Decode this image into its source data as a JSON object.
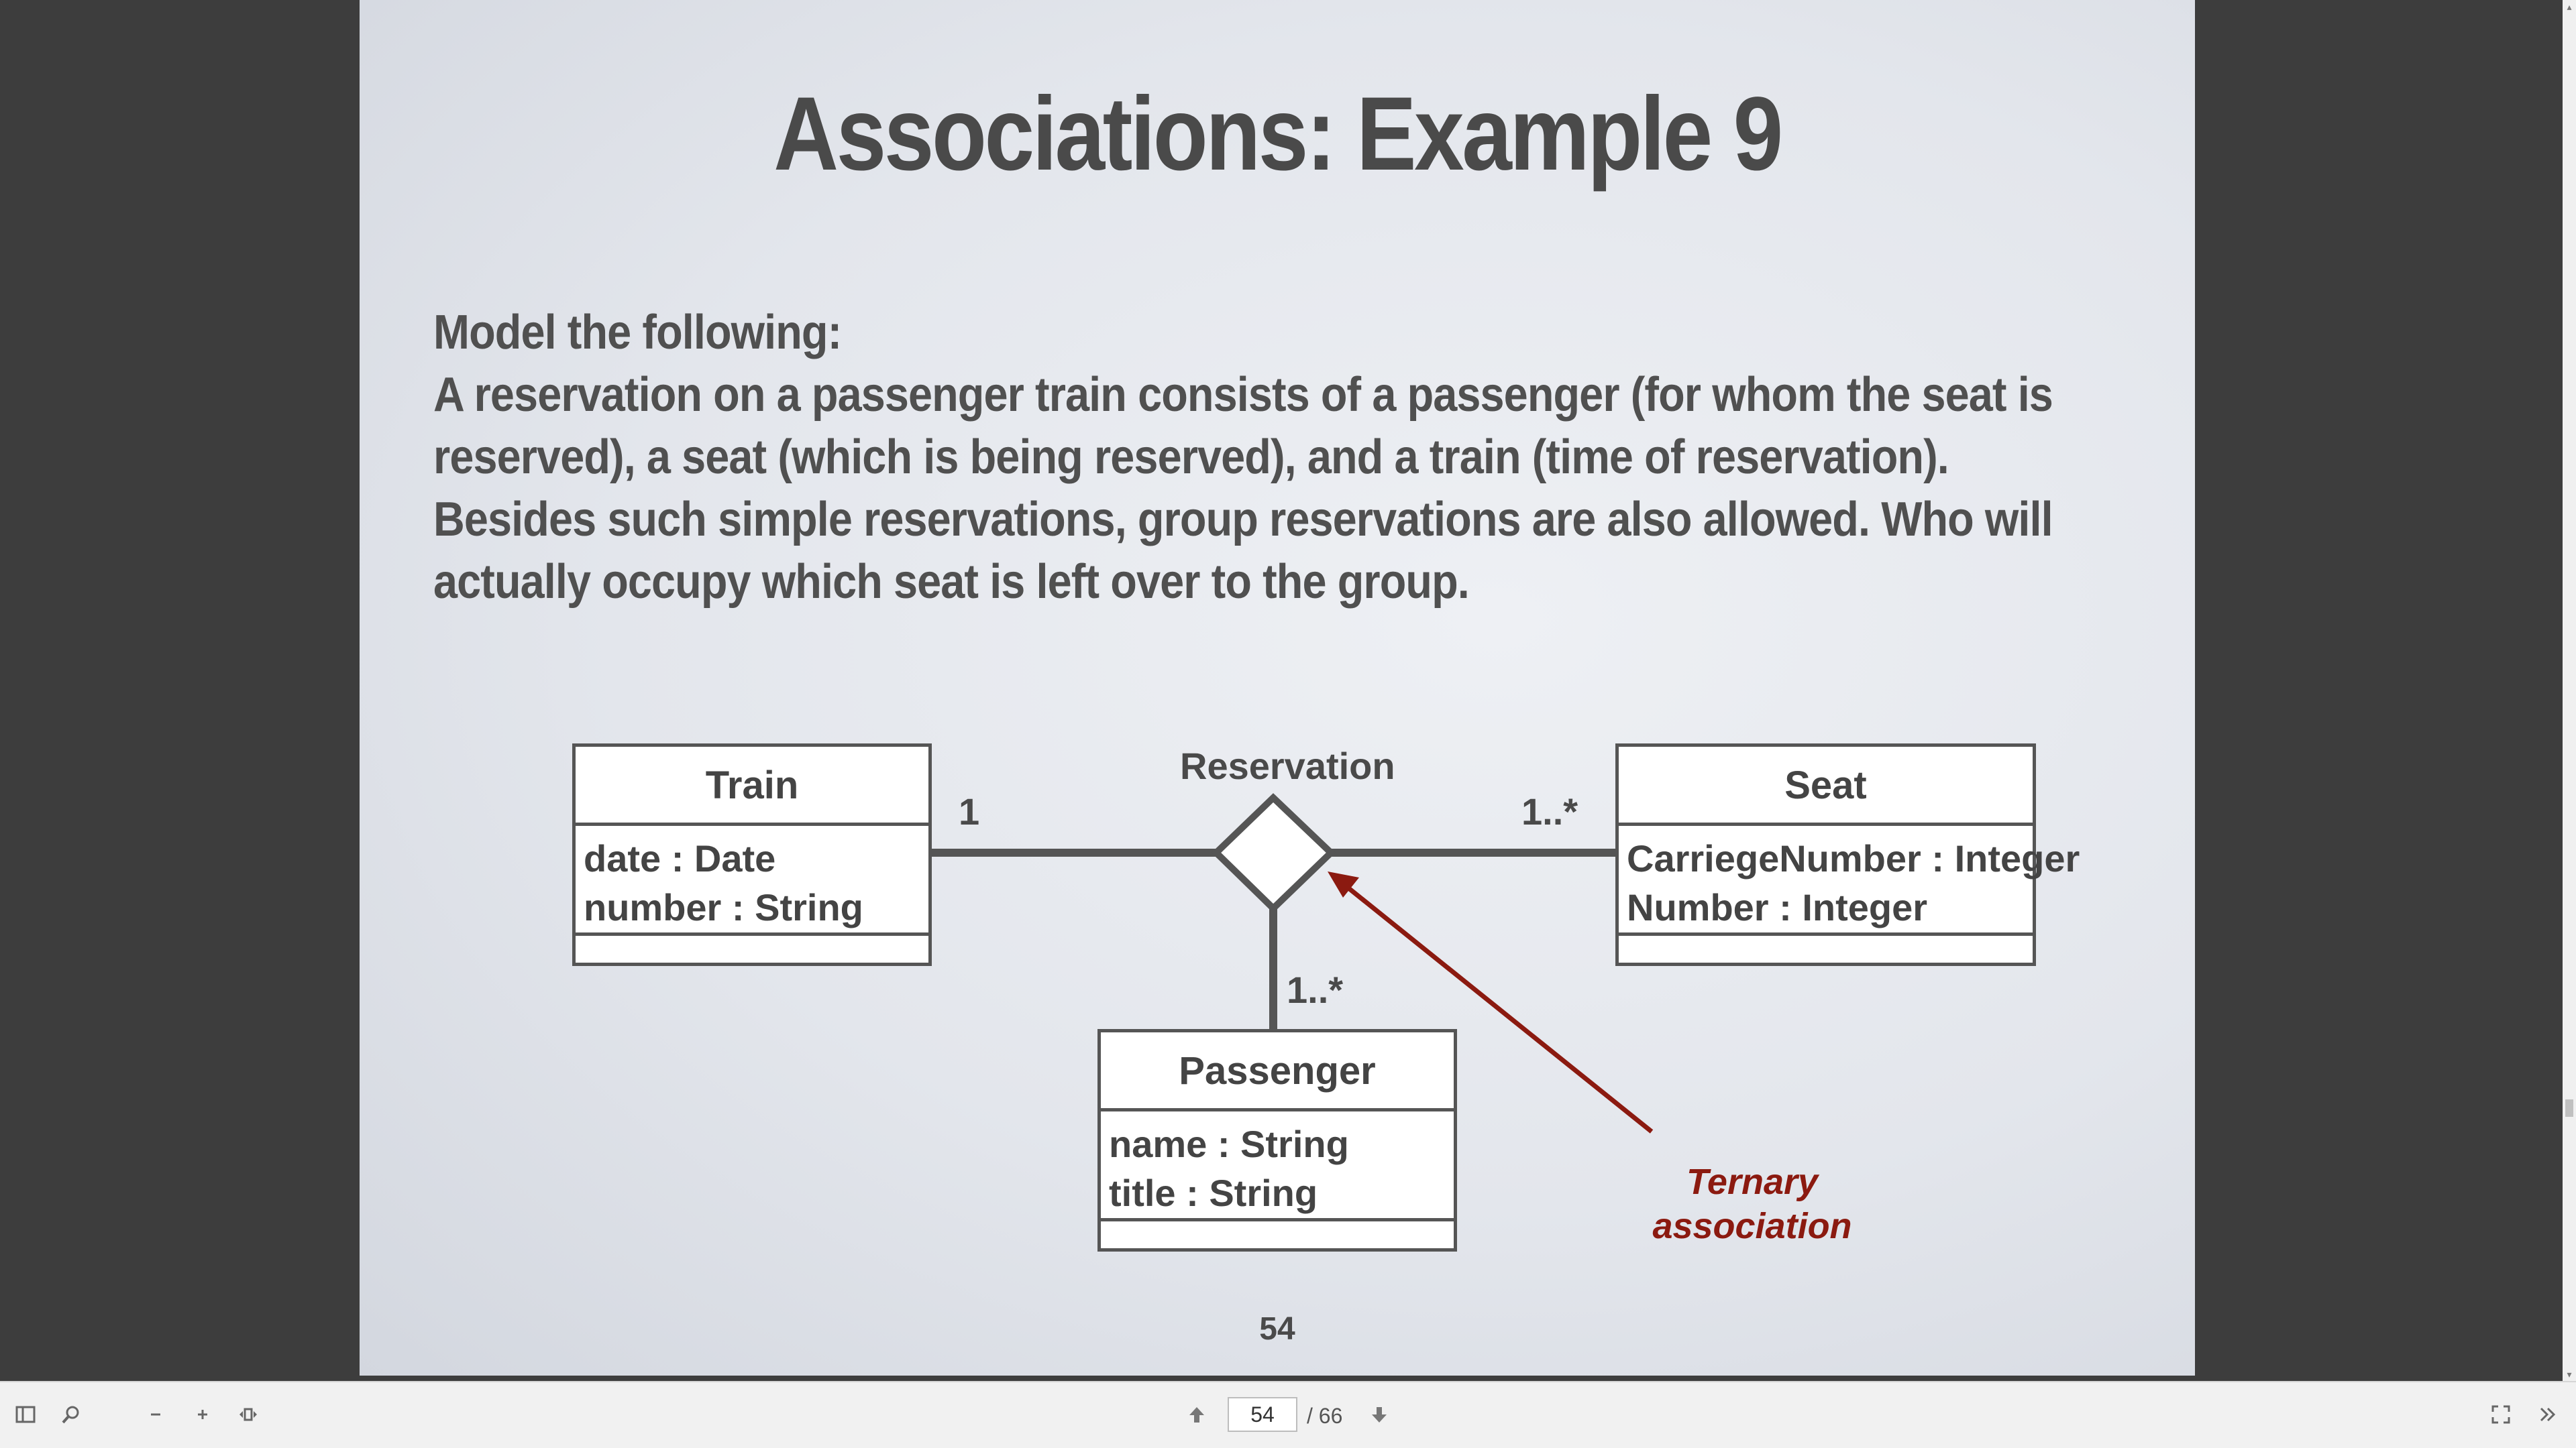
{
  "slide": {
    "title": "Associations: Example 9",
    "body_lines": [
      "Model the following:",
      "A reservation on a passenger train consists of a passenger (for whom the seat is",
      "reserved), a seat (which is being reserved), and a train (time of reservation).",
      "Besides such simple reservations, group reservations are also allowed. Who will",
      "actually occupy which seat is left over to the group."
    ],
    "page_number": "54"
  },
  "diagram": {
    "association_name": "Reservation",
    "classes": {
      "train": {
        "name": "Train",
        "attributes": [
          "date : Date",
          "number : String"
        ]
      },
      "seat": {
        "name": "Seat",
        "attributes": [
          "CarriegeNumber : Integer",
          "Number : Integer"
        ]
      },
      "passenger": {
        "name": "Passenger",
        "attributes": [
          "name : String",
          "title : String"
        ]
      }
    },
    "multiplicities": {
      "train": "1",
      "seat": "1..*",
      "passenger": "1..*"
    },
    "annotation": {
      "line1": "Ternary",
      "line2": "association",
      "color": "#8b1a10"
    }
  },
  "toolbar": {
    "current_page": "54",
    "total_pages": "/ 66",
    "icons": [
      "sidebar-toggle-icon",
      "search-icon",
      "zoom-out-icon",
      "zoom-in-icon",
      "fit-page-icon",
      "previous-page-icon",
      "next-page-icon",
      "fullscreen-icon",
      "more-tools-icon"
    ]
  }
}
